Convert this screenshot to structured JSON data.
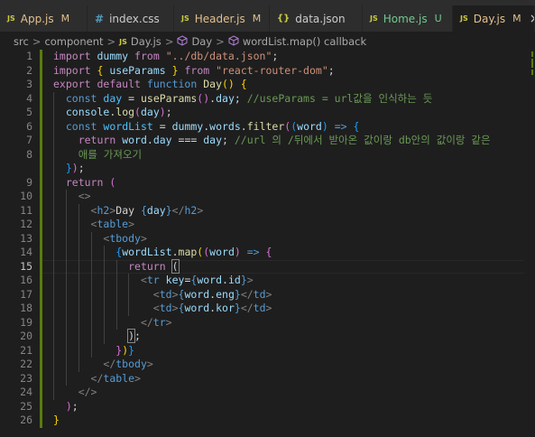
{
  "tabs": [
    {
      "icon": "JS",
      "name": "App.js",
      "status": "M",
      "name_color": "#e2c08d",
      "status_color": "#e2c08d",
      "active": false
    },
    {
      "icon": "#",
      "name": "index.css",
      "status": "",
      "name_color": "#cccccc",
      "status_color": "#cccccc",
      "active": false
    },
    {
      "icon": "JS",
      "name": "Header.js",
      "status": "M",
      "name_color": "#e2c08d",
      "status_color": "#e2c08d",
      "active": false
    },
    {
      "icon": "{}",
      "name": "data.json",
      "status": "",
      "name_color": "#cccccc",
      "status_color": "#cccccc",
      "active": false
    },
    {
      "icon": "JS",
      "name": "Home.js",
      "status": "U",
      "name_color": "#73c991",
      "status_color": "#73c991",
      "active": false
    },
    {
      "icon": "JS",
      "name": "Day.js",
      "status": "M",
      "name_color": "#e2c08d",
      "status_color": "#e2c08d",
      "active": true
    }
  ],
  "close_glyph": "×",
  "breadcrumb": {
    "src": "src",
    "component": "component",
    "file": "Day.js",
    "symbol1": "Day",
    "symbol2": "wordList.map() callback",
    "sep": ">",
    "js_icon": "JS"
  },
  "current_line": 15,
  "modified_lines": [
    1,
    2,
    3,
    4,
    5,
    6,
    7,
    8,
    9,
    10,
    11,
    12,
    13,
    14,
    15,
    16,
    17,
    18,
    19,
    20,
    21,
    22,
    23,
    24,
    25,
    26
  ],
  "line_numbers": [
    "1",
    "2",
    "3",
    "4",
    "5",
    "6",
    "7",
    "8",
    "",
    "9",
    "10",
    "11",
    "12",
    "13",
    "14",
    "15",
    "16",
    "17",
    "18",
    "19",
    "20",
    "21",
    "22",
    "23",
    "24",
    "25",
    "26"
  ],
  "code_lines": [
    [
      [
        "kw",
        "import"
      ],
      [
        "tx",
        " "
      ],
      [
        "va",
        "dummy"
      ],
      [
        "tx",
        " "
      ],
      [
        "kw",
        "from"
      ],
      [
        "tx",
        " "
      ],
      [
        "st2",
        "\"../db/data.json\""
      ],
      [
        "tx",
        ";"
      ]
    ],
    [
      [
        "kw",
        "import"
      ],
      [
        "tx",
        " "
      ],
      [
        "br1",
        "{"
      ],
      [
        "tx",
        " "
      ],
      [
        "va",
        "useParams"
      ],
      [
        "tx",
        " "
      ],
      [
        "br1",
        "}"
      ],
      [
        "tx",
        " "
      ],
      [
        "kw",
        "from"
      ],
      [
        "tx",
        " "
      ],
      [
        "st2",
        "\"react-router-dom\""
      ],
      [
        "tx",
        ";"
      ]
    ],
    [
      [
        "kw",
        "export"
      ],
      [
        "tx",
        " "
      ],
      [
        "kw",
        "default"
      ],
      [
        "tx",
        " "
      ],
      [
        "kb",
        "function"
      ],
      [
        "tx",
        " "
      ],
      [
        "fn",
        "Day"
      ],
      [
        "br1",
        "()"
      ],
      [
        "tx",
        " "
      ],
      [
        "br1",
        "{"
      ]
    ],
    [
      [
        "tx",
        "  "
      ],
      [
        "kb",
        "const"
      ],
      [
        "tx",
        " "
      ],
      [
        "co",
        "day"
      ],
      [
        "tx",
        " = "
      ],
      [
        "fn",
        "useParams"
      ],
      [
        "br2",
        "()"
      ],
      [
        "tx",
        "."
      ],
      [
        "va",
        "day"
      ],
      [
        "tx",
        "; "
      ],
      [
        "cm",
        "//useParams = url값을 인식하는 듯"
      ]
    ],
    [
      [
        "tx",
        "  "
      ],
      [
        "va",
        "console"
      ],
      [
        "tx",
        "."
      ],
      [
        "fn",
        "log"
      ],
      [
        "br2",
        "("
      ],
      [
        "va",
        "day"
      ],
      [
        "br2",
        ")"
      ],
      [
        "tx",
        ";"
      ]
    ],
    [
      [
        "tx",
        "  "
      ],
      [
        "kb",
        "const"
      ],
      [
        "tx",
        " "
      ],
      [
        "co",
        "wordList"
      ],
      [
        "tx",
        " = "
      ],
      [
        "va",
        "dummy"
      ],
      [
        "tx",
        "."
      ],
      [
        "va",
        "words"
      ],
      [
        "tx",
        "."
      ],
      [
        "fn",
        "filter"
      ],
      [
        "br2",
        "("
      ],
      [
        "br3",
        "("
      ],
      [
        "va",
        "word"
      ],
      [
        "br3",
        ")"
      ],
      [
        "tx",
        " "
      ],
      [
        "kb",
        "=>"
      ],
      [
        "tx",
        " "
      ],
      [
        "br3",
        "{"
      ]
    ],
    [
      [
        "tx",
        "    "
      ],
      [
        "kw",
        "return"
      ],
      [
        "tx",
        " "
      ],
      [
        "va",
        "word"
      ],
      [
        "tx",
        "."
      ],
      [
        "va",
        "day"
      ],
      [
        "tx",
        " === "
      ],
      [
        "va",
        "day"
      ],
      [
        "tx",
        "; "
      ],
      [
        "cm",
        "//url 의 /뒤에서 받아온 값이랑 db안의 값이랑 같은"
      ]
    ],
    [
      [
        "tx",
        "    "
      ],
      [
        "cm",
        "애를 가져오기"
      ]
    ],
    [
      [
        "tx",
        "  "
      ],
      [
        "br3",
        "}"
      ],
      [
        "br2",
        ")"
      ],
      [
        "tx",
        ";"
      ]
    ],
    [
      [
        "tx",
        "  "
      ],
      [
        "kw",
        "return"
      ],
      [
        "tx",
        " "
      ],
      [
        "br2",
        "("
      ]
    ],
    [
      [
        "tx",
        "    "
      ],
      [
        "pu",
        "<>"
      ]
    ],
    [
      [
        "tx",
        "      "
      ],
      [
        "pu",
        "<"
      ],
      [
        "tg",
        "h2"
      ],
      [
        "pu",
        ">"
      ],
      [
        "tx",
        "Day "
      ],
      [
        "kb",
        "{"
      ],
      [
        "va",
        "day"
      ],
      [
        "kb",
        "}"
      ],
      [
        "pu",
        "</"
      ],
      [
        "tg",
        "h2"
      ],
      [
        "pu",
        ">"
      ]
    ],
    [
      [
        "tx",
        "      "
      ],
      [
        "pu",
        "<"
      ],
      [
        "tg",
        "table"
      ],
      [
        "pu",
        ">"
      ]
    ],
    [
      [
        "tx",
        "        "
      ],
      [
        "pu",
        "<"
      ],
      [
        "tg",
        "tbody"
      ],
      [
        "pu",
        ">"
      ]
    ],
    [
      [
        "tx",
        "          "
      ],
      [
        "br3",
        "{"
      ],
      [
        "va",
        "wordList"
      ],
      [
        "tx",
        "."
      ],
      [
        "fn",
        "map"
      ],
      [
        "br1",
        "("
      ],
      [
        "br2",
        "("
      ],
      [
        "va",
        "word"
      ],
      [
        "br2",
        ")"
      ],
      [
        "tx",
        " "
      ],
      [
        "kb",
        "=>"
      ],
      [
        "tx",
        " "
      ],
      [
        "br2",
        "{"
      ]
    ],
    [
      [
        "tx",
        "            "
      ],
      [
        "kw",
        "return"
      ],
      [
        "tx",
        " "
      ],
      [
        "mb",
        "("
      ]
    ],
    [
      [
        "tx",
        "              "
      ],
      [
        "pu",
        "<"
      ],
      [
        "tg",
        "tr"
      ],
      [
        "tx",
        " "
      ],
      [
        "at",
        "key"
      ],
      [
        "tx",
        "="
      ],
      [
        "kb",
        "{"
      ],
      [
        "va",
        "word"
      ],
      [
        "tx",
        "."
      ],
      [
        "va",
        "id"
      ],
      [
        "kb",
        "}"
      ],
      [
        "pu",
        ">"
      ]
    ],
    [
      [
        "tx",
        "                "
      ],
      [
        "pu",
        "<"
      ],
      [
        "tg",
        "td"
      ],
      [
        "pu",
        ">"
      ],
      [
        "kb",
        "{"
      ],
      [
        "va",
        "word"
      ],
      [
        "tx",
        "."
      ],
      [
        "va",
        "eng"
      ],
      [
        "kb",
        "}"
      ],
      [
        "pu",
        "</"
      ],
      [
        "tg",
        "td"
      ],
      [
        "pu",
        ">"
      ]
    ],
    [
      [
        "tx",
        "                "
      ],
      [
        "pu",
        "<"
      ],
      [
        "tg",
        "td"
      ],
      [
        "pu",
        ">"
      ],
      [
        "kb",
        "{"
      ],
      [
        "va",
        "word"
      ],
      [
        "tx",
        "."
      ],
      [
        "va",
        "kor"
      ],
      [
        "kb",
        "}"
      ],
      [
        "pu",
        "</"
      ],
      [
        "tg",
        "td"
      ],
      [
        "pu",
        ">"
      ]
    ],
    [
      [
        "tx",
        "              "
      ],
      [
        "pu",
        "</"
      ],
      [
        "tg",
        "tr"
      ],
      [
        "pu",
        ">"
      ]
    ],
    [
      [
        "tx",
        "            "
      ],
      [
        "mb",
        ")"
      ],
      [
        "tx",
        ";"
      ]
    ],
    [
      [
        "tx",
        "          "
      ],
      [
        "br2",
        "}"
      ],
      [
        "br1",
        ")"
      ],
      [
        "br3",
        "}"
      ]
    ],
    [
      [
        "tx",
        "        "
      ],
      [
        "pu",
        "</"
      ],
      [
        "tg",
        "tbody"
      ],
      [
        "pu",
        ">"
      ]
    ],
    [
      [
        "tx",
        "      "
      ],
      [
        "pu",
        "</"
      ],
      [
        "tg",
        "table"
      ],
      [
        "pu",
        ">"
      ]
    ],
    [
      [
        "tx",
        "    "
      ],
      [
        "pu",
        "</>"
      ]
    ],
    [
      [
        "tx",
        "  "
      ],
      [
        "br2",
        ")"
      ],
      [
        "tx",
        ";"
      ]
    ],
    [
      [
        "br1",
        "}"
      ]
    ]
  ]
}
